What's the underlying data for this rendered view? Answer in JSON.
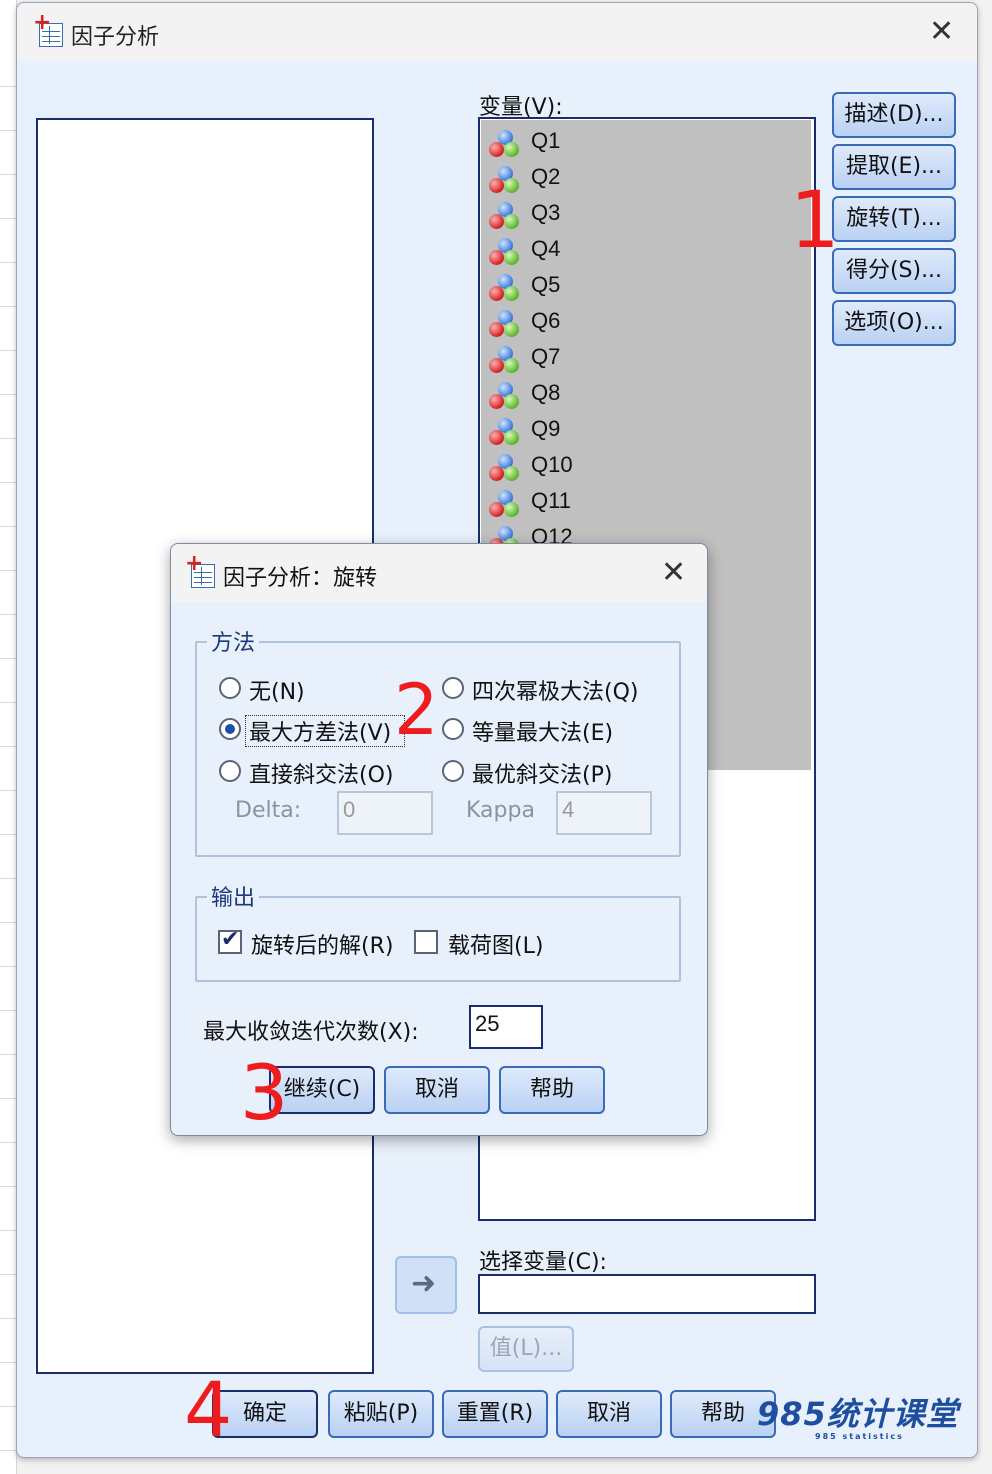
{
  "main_dialog": {
    "title": "因子分析",
    "variables_label": "变量(V):",
    "variables": [
      "Q1",
      "Q2",
      "Q3",
      "Q4",
      "Q5",
      "Q6",
      "Q7",
      "Q8",
      "Q9",
      "Q10",
      "Q11",
      "Q12"
    ],
    "side_buttons": [
      "描述(D)...",
      "提取(E)...",
      "旋转(T)...",
      "得分(S)...",
      "选项(O)..."
    ],
    "selection_label": "选择变量(C):",
    "value_button": "值(L)...",
    "bottom_buttons": [
      "确定",
      "粘贴(P)",
      "重置(R)",
      "取消",
      "帮助"
    ]
  },
  "rotation_dialog": {
    "title": "因子分析：旋转",
    "method_group": "方法",
    "methods": [
      {
        "label": "无(N)",
        "selected": false
      },
      {
        "label": "四次幂极大法(Q)",
        "selected": false
      },
      {
        "label": "最大方差法(V)",
        "selected": true
      },
      {
        "label": "等量最大法(E)",
        "selected": false
      },
      {
        "label": "直接斜交法(O)",
        "selected": false
      },
      {
        "label": "最优斜交法(P)",
        "selected": false
      }
    ],
    "delta_label": "Delta:",
    "delta_value": "0",
    "kappa_label": "Kappa",
    "kappa_value": "4",
    "output_group": "输出",
    "rotated_solution": {
      "label": "旋转后的解(R)",
      "checked": true
    },
    "loading_plot": {
      "label": "载荷图(L)",
      "checked": false
    },
    "max_iter_label": "最大收敛迭代次数(X):",
    "max_iter_value": "25",
    "buttons": [
      "继续(C)",
      "取消",
      "帮助"
    ]
  },
  "annotations": [
    "1",
    "2",
    "3",
    "4"
  ],
  "watermark": {
    "main": "985统计课堂",
    "sub": "985 statistics"
  },
  "colors": {
    "annotation": "#ee1c1c",
    "accent": "#1c4fa6",
    "dialog_bg": "#e8f0fb"
  }
}
